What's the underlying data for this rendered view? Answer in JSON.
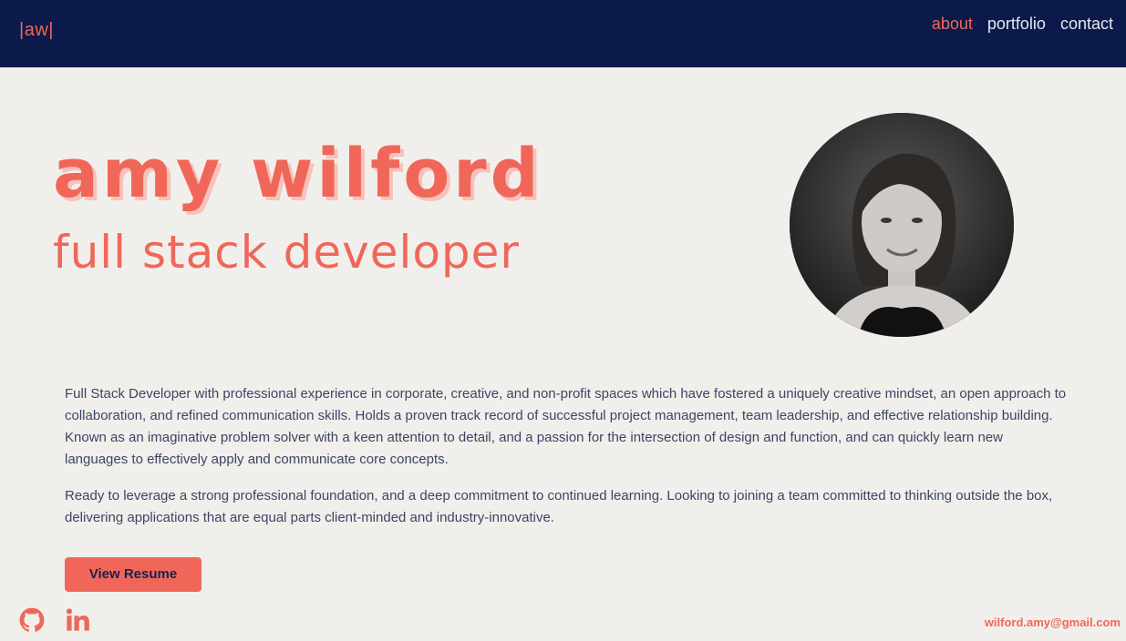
{
  "header": {
    "logo": "|aw|",
    "nav": [
      {
        "label": "about",
        "active": true
      },
      {
        "label": "portfolio",
        "active": false
      },
      {
        "label": "contact",
        "active": false
      }
    ]
  },
  "hero": {
    "name": "amy wilford",
    "role": "full stack developer"
  },
  "bio": {
    "paragraph_1": "Full Stack Developer with professional experience in corporate, creative, and non-profit spaces which have fostered a uniquely creative mindset, an open approach to collaboration, and refined communication skills. Holds a proven track record of successful project management, team leadership, and effective relationship building. Known as an imaginative problem solver with a keen attention to detail, and a passion for the intersection of design and function, and can quickly learn new languages to effectively apply and communicate core concepts.",
    "paragraph_2": "Ready to leverage a strong professional foundation, and a deep commitment to continued learning. Looking to joining a team committed to thinking outside the box, delivering applications that are equal parts client-minded and industry-innovative."
  },
  "resume_button": "View Resume",
  "footer": {
    "social": [
      "github-icon",
      "linkedin-icon"
    ],
    "email": "wilford.amy@gmail.com"
  },
  "colors": {
    "navy": "#0b1a4a",
    "coral": "#f0675a",
    "background": "#f1efeb"
  }
}
